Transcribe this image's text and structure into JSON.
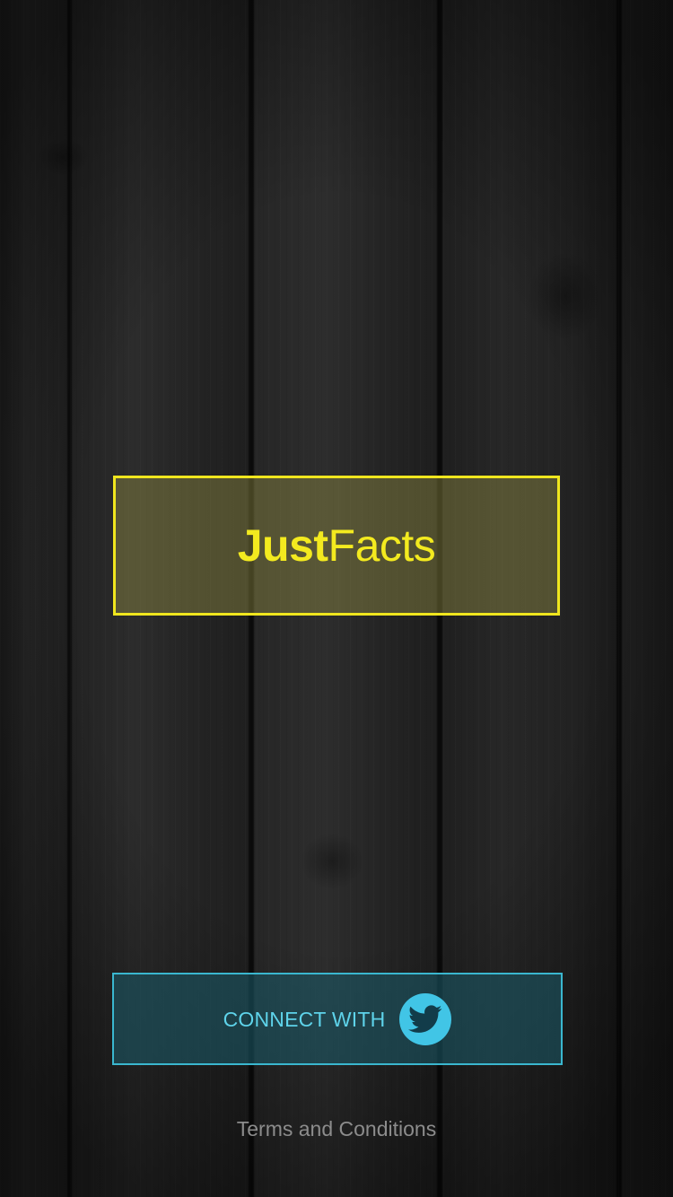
{
  "logo": {
    "bold_part": "Just",
    "regular_part": "Facts"
  },
  "connect": {
    "label": "CONNECT WITH",
    "icon": "twitter-bird-icon"
  },
  "footer": {
    "terms_label": "Terms and Conditions"
  },
  "colors": {
    "accent_yellow": "#f3ea1f",
    "accent_cyan": "#41c5e6",
    "background": "#1f1f1f"
  }
}
